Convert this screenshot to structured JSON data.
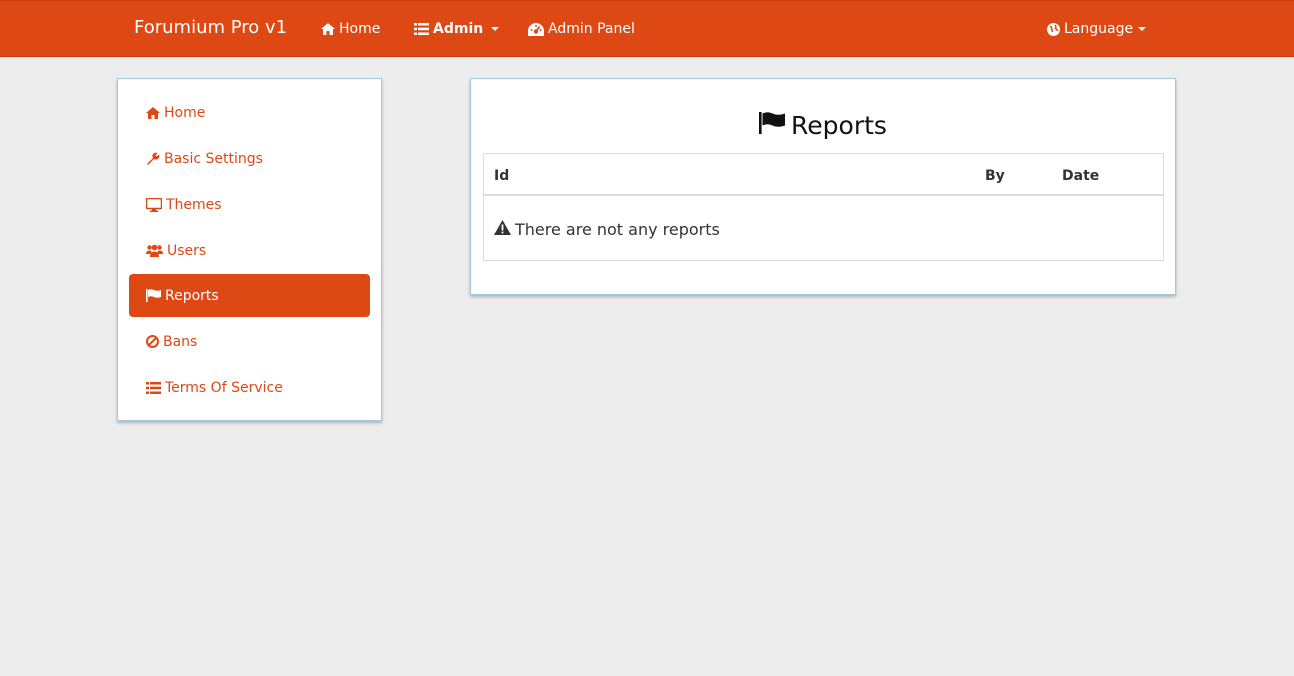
{
  "navbar": {
    "brand": "Forumium Pro v1",
    "home_label": "Home",
    "admin_label": "Admin",
    "admin_panel_label": "Admin Panel",
    "language_label": "Language",
    "color": "#dd4814"
  },
  "sidebar": {
    "items": [
      {
        "label": "Home",
        "icon": "home-icon"
      },
      {
        "label": "Basic Settings",
        "icon": "wrench-icon"
      },
      {
        "label": "Themes",
        "icon": "desktop-icon"
      },
      {
        "label": "Users",
        "icon": "users-icon"
      },
      {
        "label": "Reports",
        "icon": "flag-icon",
        "active": true
      },
      {
        "label": "Bans",
        "icon": "ban-icon"
      },
      {
        "label": "Terms Of Service",
        "icon": "list-icon"
      }
    ]
  },
  "main": {
    "title": "Reports",
    "title_icon": "flag-icon",
    "table": {
      "columns": [
        "Id",
        "By",
        "Date"
      ],
      "empty_message": "There are not any reports",
      "empty_icon": "warning-icon"
    }
  }
}
